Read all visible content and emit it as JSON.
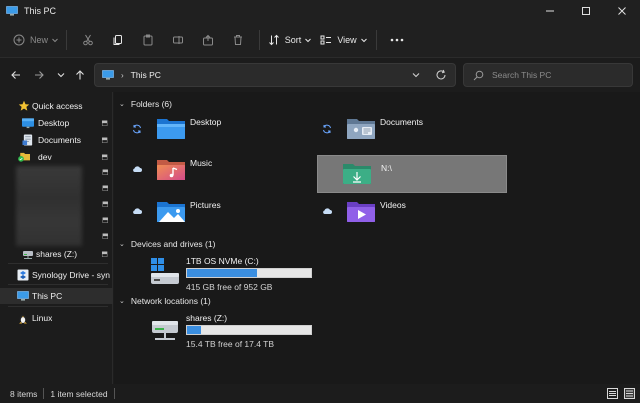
{
  "window": {
    "title": "This PC"
  },
  "toolbar": {
    "new_label": "New",
    "sort_label": "Sort",
    "view_label": "View"
  },
  "address": {
    "current": "This PC"
  },
  "search": {
    "placeholder": "Search This PC"
  },
  "sidebar": {
    "quick_access": "Quick access",
    "items": [
      {
        "label": "Desktop"
      },
      {
        "label": "Documents"
      },
      {
        "label": "dev"
      }
    ],
    "shares": "shares (Z:)",
    "synology": "Synology Drive - syn",
    "this_pc": "This PC",
    "linux": "Linux"
  },
  "groups": {
    "folders": "Folders (6)",
    "devices": "Devices and drives (1)",
    "network": "Network locations (1)"
  },
  "folders": [
    {
      "name": "Desktop"
    },
    {
      "name": "Documents"
    },
    {
      "name": "Music"
    },
    {
      "name": "N:\\"
    },
    {
      "name": "Pictures"
    },
    {
      "name": "Videos"
    }
  ],
  "drives": [
    {
      "name": "1TB OS NVMe (C:)",
      "free": "415 GB free of 952 GB",
      "used_fraction": 0.564
    },
    {
      "name": "shares (Z:)",
      "free": "15.4 TB free of 17.4 TB",
      "used_fraction": 0.115
    }
  ],
  "statusbar": {
    "items": "8 items",
    "selected": "1 item selected"
  },
  "colors": {
    "accent": "#3a8ee0",
    "selection": "#777777",
    "folder_blue": "#4aa3ee"
  }
}
